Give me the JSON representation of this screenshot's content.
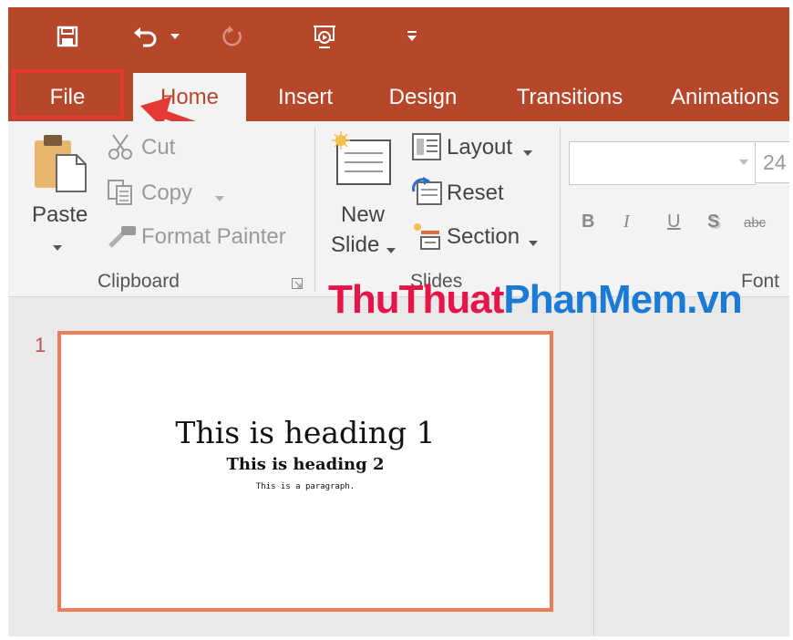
{
  "quick_access": {
    "icons": [
      "save-icon",
      "undo-icon",
      "dropdown-caret-icon",
      "redo-icon",
      "present-from-start-icon",
      "customize-qat-icon"
    ]
  },
  "tabs": [
    {
      "label": "File"
    },
    {
      "label": "Home"
    },
    {
      "label": "Insert"
    },
    {
      "label": "Design"
    },
    {
      "label": "Transitions"
    },
    {
      "label": "Animations"
    }
  ],
  "clipboard": {
    "paste": "Paste",
    "cut": "Cut",
    "copy": "Copy",
    "format_painter": "Format Painter",
    "group_label": "Clipboard"
  },
  "slides_group": {
    "new_slide_line1": "New",
    "new_slide_line2": "Slide",
    "layout": "Layout",
    "reset": "Reset",
    "section": "Section",
    "group_label": "Slides"
  },
  "font_group": {
    "font_name_value": "",
    "font_size_value": "24",
    "bold": "B",
    "italic": "I",
    "underline": "U",
    "shadow": "S",
    "strikethrough": "abc",
    "group_label": "Font"
  },
  "watermark": {
    "part1": "ThuThuat",
    "part2": "PhanMem.vn"
  },
  "slide_panel": {
    "slide_number": "1",
    "heading1": "This is heading 1",
    "heading2": "This is heading 2",
    "paragraph": "This is a paragraph."
  },
  "colors": {
    "accent": "#b7472a",
    "annotation": "#e53935",
    "slide_border": "#ed7d57"
  }
}
